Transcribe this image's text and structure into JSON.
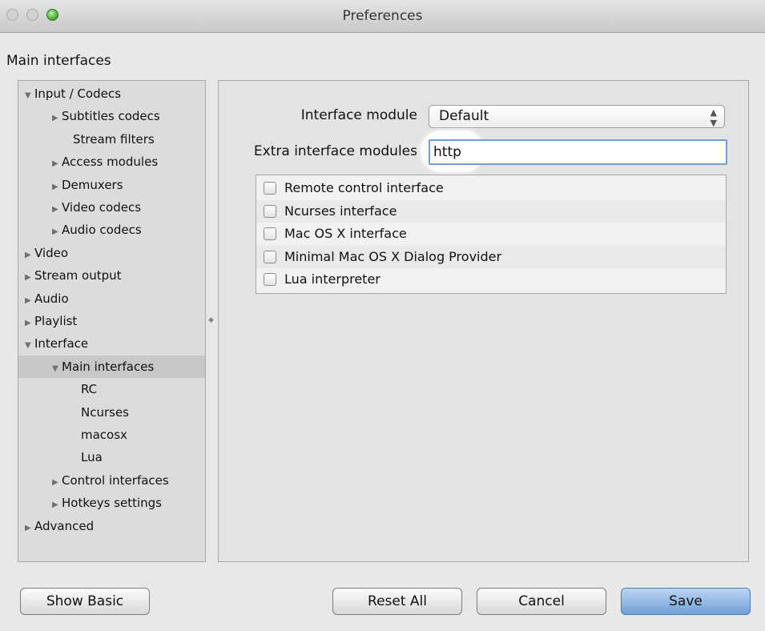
{
  "window": {
    "title": "Preferences"
  },
  "section_title": "Main interfaces",
  "tree": [
    {
      "label": "Input / Codecs",
      "expanded": true,
      "expander": "triangle-down-icon"
    },
    {
      "label": "Subtitles codecs",
      "expander": "triangle-right-icon"
    },
    {
      "label": "Stream filters"
    },
    {
      "label": "Access modules",
      "expander": "triangle-right-icon"
    },
    {
      "label": "Demuxers",
      "expander": "triangle-right-icon"
    },
    {
      "label": "Video codecs",
      "expander": "triangle-right-icon"
    },
    {
      "label": "Audio codecs",
      "expander": "triangle-right-icon"
    },
    {
      "label": "Video",
      "expander": "triangle-right-icon"
    },
    {
      "label": "Stream output",
      "expander": "triangle-right-icon"
    },
    {
      "label": "Audio",
      "expander": "triangle-right-icon"
    },
    {
      "label": "Playlist",
      "expander": "triangle-right-icon"
    },
    {
      "label": "Interface",
      "expanded": true,
      "expander": "triangle-down-icon"
    },
    {
      "label": "Main interfaces",
      "expanded": true,
      "selected": true,
      "expander": "triangle-down-icon"
    },
    {
      "label": "RC"
    },
    {
      "label": "Ncurses"
    },
    {
      "label": "macosx"
    },
    {
      "label": "Lua"
    },
    {
      "label": "Control interfaces",
      "expander": "triangle-right-icon"
    },
    {
      "label": "Hotkeys settings",
      "expander": "triangle-right-icon"
    },
    {
      "label": "Advanced",
      "expander": "triangle-right-icon"
    }
  ],
  "form": {
    "interface_module_label": "Interface module",
    "interface_module_value": "Default",
    "extra_modules_label": "Extra interface modules",
    "extra_modules_value": "http",
    "modules": [
      {
        "label": "Remote control interface",
        "checked": false
      },
      {
        "label": "Ncurses interface",
        "checked": false
      },
      {
        "label": "Mac OS X interface",
        "checked": false
      },
      {
        "label": "Minimal Mac OS X Dialog Provider",
        "checked": false
      },
      {
        "label": "Lua interpreter",
        "checked": false
      }
    ]
  },
  "buttons": {
    "show_basic": "Show Basic",
    "reset_all": "Reset All",
    "cancel": "Cancel",
    "save": "Save"
  },
  "colors": {
    "accent": "#6ea0d8",
    "selection": "#c7c7c7"
  }
}
